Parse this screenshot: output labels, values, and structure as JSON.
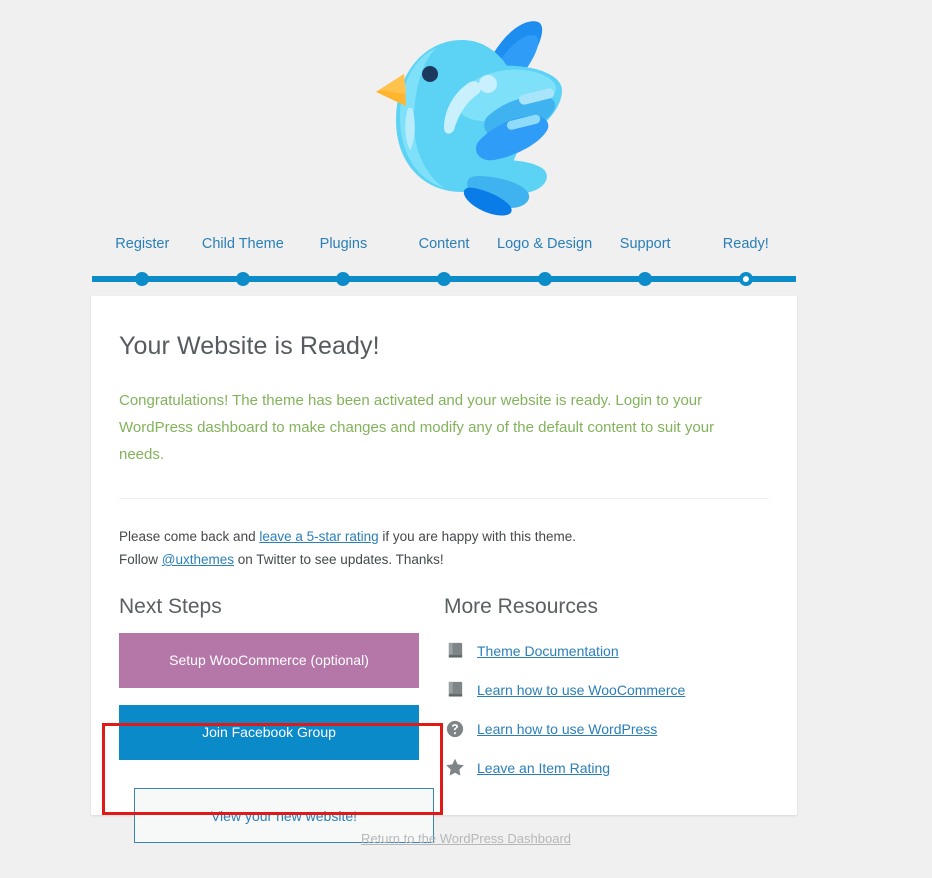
{
  "page": {
    "background_color": "#f0f0f0",
    "accent_color": "#0c8dca",
    "link_color": "#2a7fb8",
    "success_text_color": "#82b35a",
    "annotation_color": "#e01b17"
  },
  "mascot": {
    "name": "blue-bird-mascot",
    "alt": "Blue bird mascot"
  },
  "steps": [
    {
      "label": "Register",
      "state": "done"
    },
    {
      "label": "Child Theme",
      "state": "done"
    },
    {
      "label": "Plugins",
      "state": "done"
    },
    {
      "label": "Content",
      "state": "done"
    },
    {
      "label": "Logo & Design",
      "state": "done"
    },
    {
      "label": "Support",
      "state": "done"
    },
    {
      "label": "Ready!",
      "state": "current"
    }
  ],
  "card": {
    "title": "Your Website is Ready!",
    "congrats": "Congratulations! The theme has been activated and your website is ready. Login to your WordPress dashboard to make changes and modify any of the default content to suit your needs.",
    "note_line_1": {
      "before": "Please come back and ",
      "link": "leave a 5-star rating",
      "after": " if you are happy with this theme."
    },
    "note_line_2": {
      "before": "Follow ",
      "link": "@uxthemes",
      "after": " on Twitter to see updates. Thanks!"
    }
  },
  "next_steps": {
    "heading": "Next Steps",
    "buttons": [
      {
        "label": "Setup WooCommerce (optional)",
        "style": "purple"
      },
      {
        "label": "Join Facebook Group",
        "style": "blue"
      },
      {
        "label": "View your new website!",
        "style": "outline",
        "highlighted": true
      }
    ]
  },
  "more_resources": {
    "heading": "More Resources",
    "items": [
      {
        "label": "Theme Documentation",
        "icon": "book-icon"
      },
      {
        "label": "Learn how to use WooCommerce",
        "icon": "book-icon"
      },
      {
        "label": "Learn how to use WordPress",
        "icon": "question-circle-icon"
      },
      {
        "label": "Leave an Item Rating",
        "icon": "star-icon"
      }
    ]
  },
  "footer": {
    "link": "Return to the WordPress Dashboard"
  }
}
